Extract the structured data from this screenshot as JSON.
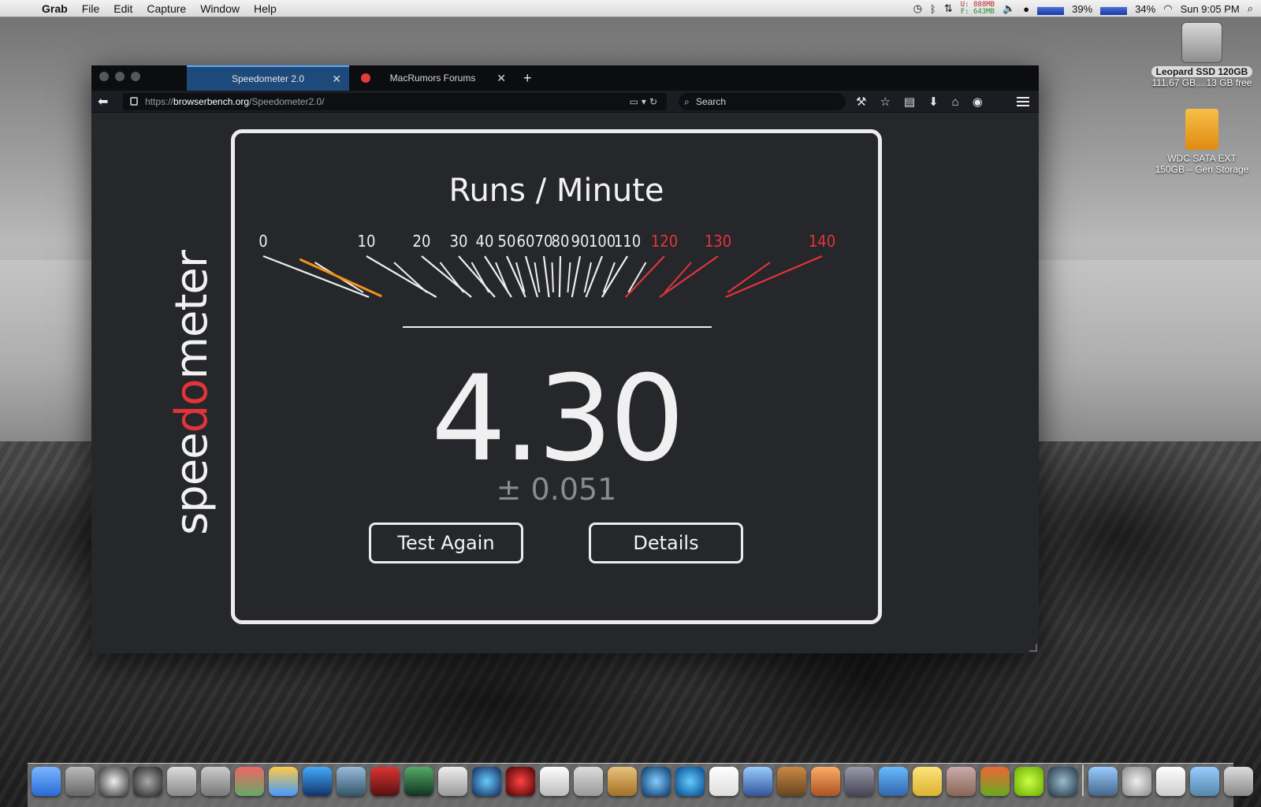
{
  "menubar": {
    "app": "Grab",
    "items": [
      "File",
      "Edit",
      "Capture",
      "Window",
      "Help"
    ],
    "memory_used": "U: 888MB",
    "memory_free": "F: 643MB",
    "cpu1": "39%",
    "cpu2": "34%",
    "clock": "Sun 9:05 PM"
  },
  "desktop": {
    "drive1_name": "Leopard SSD 120GB",
    "drive1_info": "111.67 GB,...13 GB free",
    "drive2_name": "WDC SATA EXT",
    "drive2_info": "150GB – Gen Storage"
  },
  "browser": {
    "tabs": [
      {
        "label": "Speedometer 2.0",
        "active": true
      },
      {
        "label": "MacRumors Forums",
        "active": false
      }
    ],
    "url_prefix": "https://",
    "url_host": "browserbench.org",
    "url_path": "/Speedometer2.0/",
    "search_placeholder": "Search"
  },
  "speedometer": {
    "logo_pre": "spee",
    "logo_red": "do",
    "logo_post": "meter",
    "title": "Runs / Minute",
    "score": "4.30",
    "error": "± 0.051",
    "test_again_label": "Test Again",
    "details_label": "Details",
    "gauge": {
      "labels": [
        "0",
        "10",
        "20",
        "30",
        "40",
        "50",
        "60",
        "70",
        "80",
        "90",
        "100",
        "110",
        "120",
        "130",
        "140"
      ],
      "red_from": 120,
      "needle_value": 4.3,
      "colors": {
        "tick": "#eeeeee",
        "red": "#e2343b",
        "needle": "#f2911b"
      }
    }
  }
}
